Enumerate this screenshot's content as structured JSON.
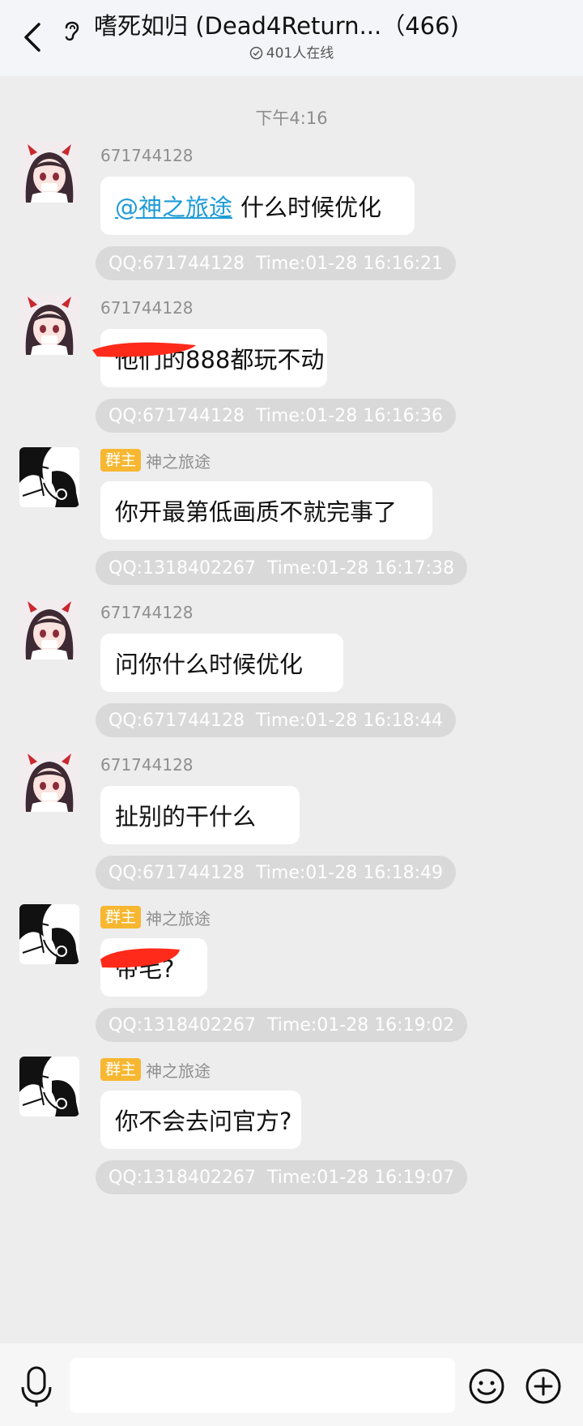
{
  "header": {
    "title": "嗜死如归 (Dead4Return...（466)",
    "online": "401人在线"
  },
  "chat": {
    "time_divider": "下午4:16",
    "messages": [
      {
        "sender": "671744128",
        "badge": "",
        "mention": "@神之旅途",
        "text": "什么时候优化",
        "qq": "QQ:671744128",
        "time": "Time:01-28 16:16:21"
      },
      {
        "sender": "671744128",
        "badge": "",
        "mention": "",
        "text": "他们的888都玩不动",
        "qq": "QQ:671744128",
        "time": "Time:01-28 16:16:36"
      },
      {
        "sender": "神之旅途",
        "badge": "群主",
        "mention": "",
        "text": "你开最第低画质不就完事了",
        "qq": "QQ:1318402267",
        "time": "Time:01-28 16:17:38"
      },
      {
        "sender": "671744128",
        "badge": "",
        "mention": "",
        "text": "问你什么时候优化",
        "qq": "QQ:671744128",
        "time": "Time:01-28 16:18:44"
      },
      {
        "sender": "671744128",
        "badge": "",
        "mention": "",
        "text": "扯别的干什么",
        "qq": "QQ:671744128",
        "time": "Time:01-28 16:18:49"
      },
      {
        "sender": "神之旅途",
        "badge": "群主",
        "mention": "",
        "text": "带毛?",
        "qq": "QQ:1318402267",
        "time": "Time:01-28 16:19:02"
      },
      {
        "sender": "神之旅途",
        "badge": "群主",
        "mention": "",
        "text": "你不会去问官方?",
        "qq": "QQ:1318402267",
        "time": "Time:01-28 16:19:07"
      }
    ]
  },
  "footer": {
    "input_placeholder": ""
  },
  "colors": {
    "background": "#ededed",
    "bubble": "#ffffff",
    "meta_pill": "#d9d9d9",
    "owner_badge": "#f7b731",
    "mention": "#1e9bd7",
    "redaction": "#ff2a1a"
  },
  "icons": [
    "back-icon",
    "ear-icon",
    "check-icon",
    "avatar-anime-girl",
    "avatar-manga",
    "mic-icon",
    "emoji-icon",
    "plus-icon"
  ]
}
